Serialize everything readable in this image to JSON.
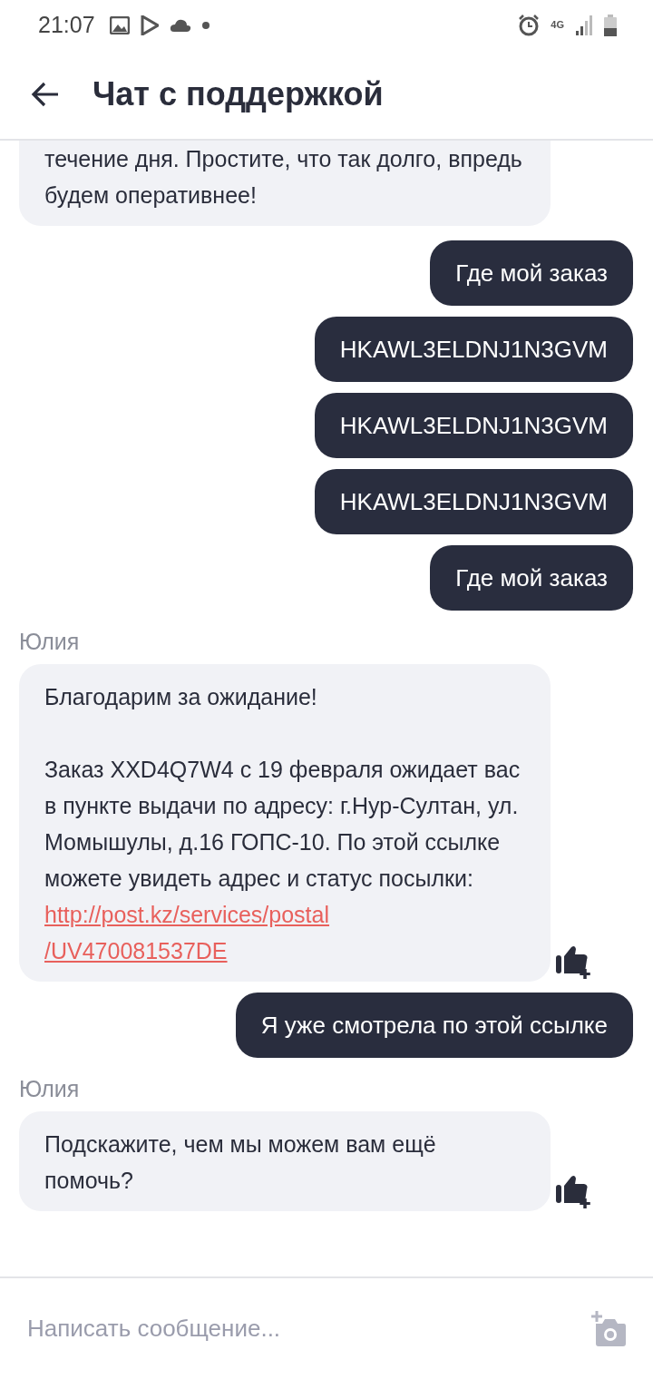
{
  "status_bar": {
    "time": "21:07",
    "network": "4G"
  },
  "header": {
    "title": "Чат с поддержкой"
  },
  "messages": [
    {
      "kind": "agent",
      "cut": true,
      "likeable": false,
      "paragraphs": [
        "течение дня. Простите, что так долго, впредь будем оперативнее!"
      ]
    },
    {
      "kind": "user",
      "text": "Где мой заказ"
    },
    {
      "kind": "user",
      "text": "HKAWL3ELDNJ1N3GVM"
    },
    {
      "kind": "user",
      "text": "HKAWL3ELDNJ1N3GVM"
    },
    {
      "kind": "user",
      "text": "HKAWL3ELDNJ1N3GVM"
    },
    {
      "kind": "user",
      "text": "Где мой заказ"
    },
    {
      "kind": "agent",
      "cut": false,
      "likeable": true,
      "sender": "Юлия",
      "paragraphs": [
        "Благодарим за ожидание!",
        "Заказ XXD4Q7W4 с 19 февраля ожидает вас в пункте выдачи по адресу: г.Нур-Султан, ул. Момышулы, д.16 ГОПС-10. По этой ссылке можете увидеть адрес и статус посылки:"
      ],
      "link_lines": [
        "http://post.kz/services/postal",
        "/UV470081537DE"
      ]
    },
    {
      "kind": "user",
      "text": "Я уже смотрела по этой ссылке"
    },
    {
      "kind": "agent",
      "cut": false,
      "likeable": true,
      "sender": "Юлия",
      "paragraphs": [
        "Подскажите, чем мы можем вам ещё помочь?"
      ]
    }
  ],
  "composer": {
    "placeholder": "Написать сообщение..."
  }
}
